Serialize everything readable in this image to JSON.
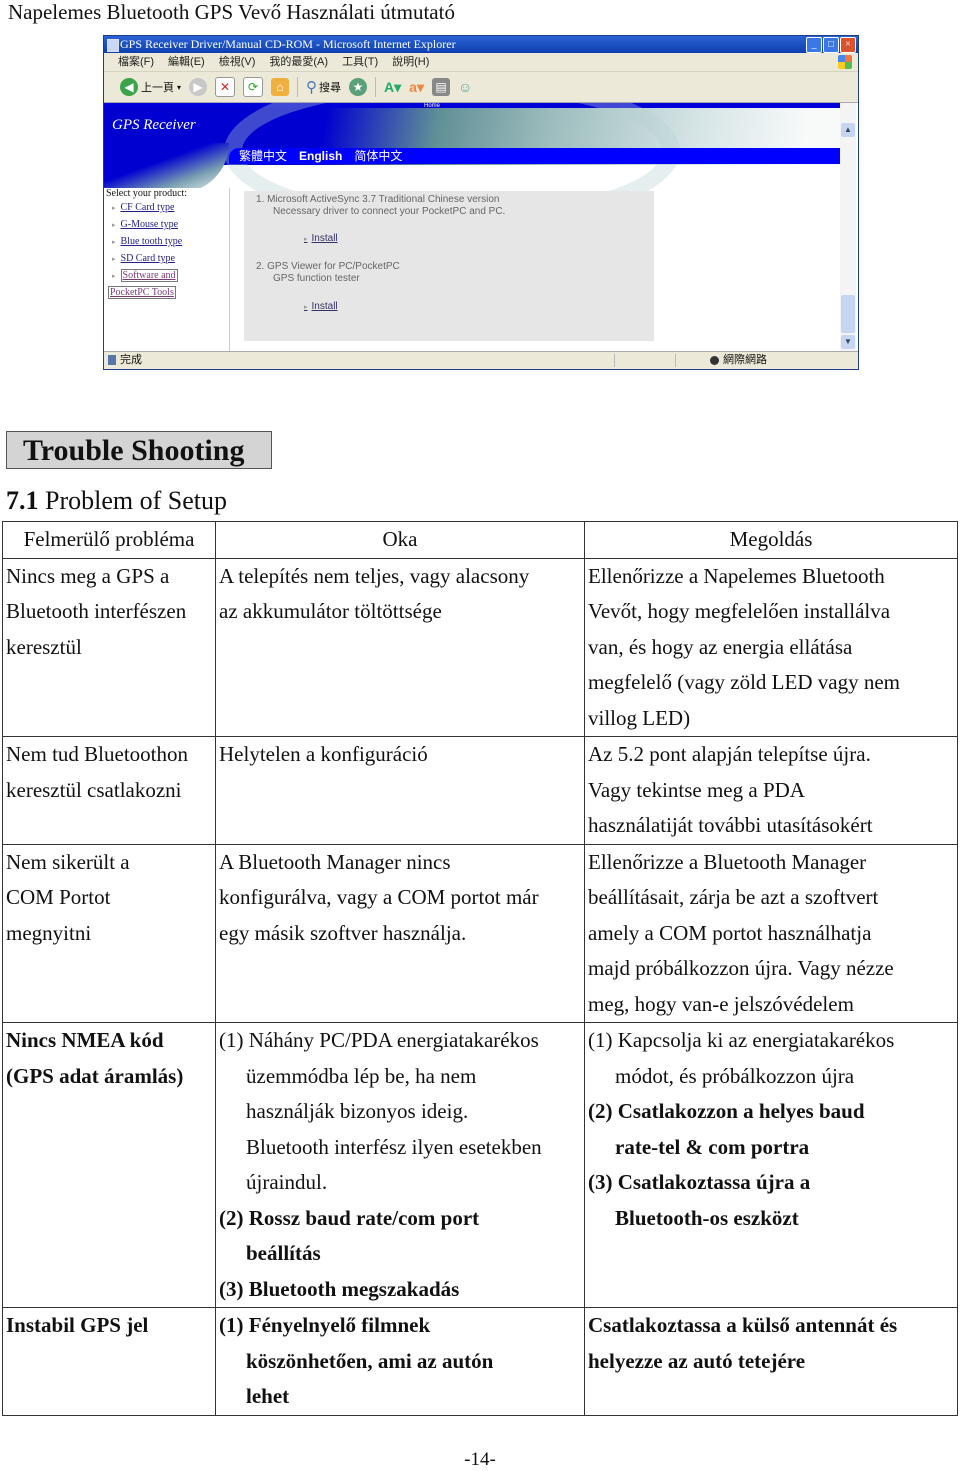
{
  "doc_header": "Napelemes Bluetooth GPS Vevő Használati útmutató",
  "screenshot": {
    "window_title": "GPS Receiver Driver/Manual CD-ROM - Microsoft Internet Explorer",
    "window_buttons": [
      "_",
      "□",
      "×"
    ],
    "menu": [
      "檔案(F)",
      "編輯(E)",
      "檢視(V)",
      "我的最愛(A)",
      "工具(T)",
      "說明(H)"
    ],
    "toolbar": {
      "back_label": "上一頁",
      "search_label": "搜尋"
    },
    "banner": {
      "home_link": "Home",
      "title": "GPS Receiver",
      "languages": [
        {
          "label": "繁體中文",
          "active": false
        },
        {
          "label": "English",
          "active": true
        },
        {
          "label": "简体中文",
          "active": false
        }
      ]
    },
    "sidebar": {
      "label": "Select your product:",
      "items": [
        "CF Card type",
        "G-Mouse type",
        "Blue tooth type",
        "SD Card type",
        "Software and",
        "PocketPC Tools"
      ]
    },
    "content": {
      "item1_line1": "1.  Microsoft ActiveSync 3.7 Traditional Chinese version",
      "item1_line2": "Necessary driver to connect your PocketPC and PC.",
      "install1": "Install",
      "item2_line1": "2.  GPS Viewer for PC/PocketPC",
      "item2_line2": "GPS function tester",
      "install2": "Install"
    },
    "status": {
      "text": "完成",
      "zone": "網際網路"
    }
  },
  "heading": "Trouble Shooting",
  "section": {
    "number": "7.1",
    "title": "Problem of Setup"
  },
  "table": {
    "headers": [
      "Felmerülő probléma",
      "Oka",
      "Megoldás"
    ],
    "rows": [
      {
        "problem": [
          "Nincs meg a GPS a",
          "Bluetooth interfészen",
          "keresztül"
        ],
        "cause": [
          "A telepítés nem teljes, vagy alacsony",
          "az akkumulátor töltöttsége"
        ],
        "solution": [
          "Ellenőrizze a Napelemes Bluetooth",
          "Vevőt, hogy megfelelően installálva",
          "van, és hogy az energia ellátása",
          "megfelelő (vagy zöld LED vagy nem",
          "villog LED)"
        ]
      },
      {
        "problem": [
          "Nem tud Bluetoothon",
          "keresztül csatlakozni"
        ],
        "cause": [
          "Helytelen a konfiguráció"
        ],
        "solution": [
          "Az 5.2 pont alapján telepítse újra.",
          "Vagy tekintse meg a PDA",
          "használatiját további utasításokért"
        ]
      },
      {
        "problem": [
          "Nem sikerült a",
          "COM Portot",
          "megnyitni"
        ],
        "cause": [
          "A Bluetooth Manager nincs",
          "konfigurálva, vagy a COM portot már",
          "egy másik szoftver használja."
        ],
        "solution": [
          "Ellenőrizze a Bluetooth Manager",
          "beállításait, zárja be azt a szoftvert",
          "amely a COM portot használhatja",
          "majd próbálkozzon újra. Vagy nézze",
          "meg, hogy van-e jelszóvédelem"
        ]
      },
      {
        "problem": [
          "Nincs NMEA kód",
          "(GPS adat áramlás)"
        ],
        "cause_1": [
          "(1) Náhány PC/PDA energiatakarékos",
          "üzemmódba lép be, ha nem",
          "használják bizonyos ideig.",
          "Bluetooth interfész ilyen esetekben",
          "újraindul."
        ],
        "cause_2": [
          "(2) Rossz baud rate/com port",
          "beállítás"
        ],
        "cause_3": [
          "(3) Bluetooth megszakadás"
        ],
        "solution_1": [
          "(1) Kapcsolja ki az energiatakarékos",
          "módot, és próbálkozzon újra"
        ],
        "solution_2": [
          "(2) Csatlakozzon a helyes baud",
          "rate-tel & com portra"
        ],
        "solution_3": [
          "(3) Csatlakoztassa újra a",
          "Bluetooth-os eszközt"
        ]
      },
      {
        "problem": [
          "Instabil GPS jel"
        ],
        "cause": [
          "(1) Fényelnyelő filmnek",
          "köszönhetően, ami az autón",
          "lehet"
        ],
        "solution": [
          "Csatlakoztassa a külső antennát és",
          "helyezze az autó tetejére"
        ]
      }
    ]
  },
  "page_number": "-14-"
}
